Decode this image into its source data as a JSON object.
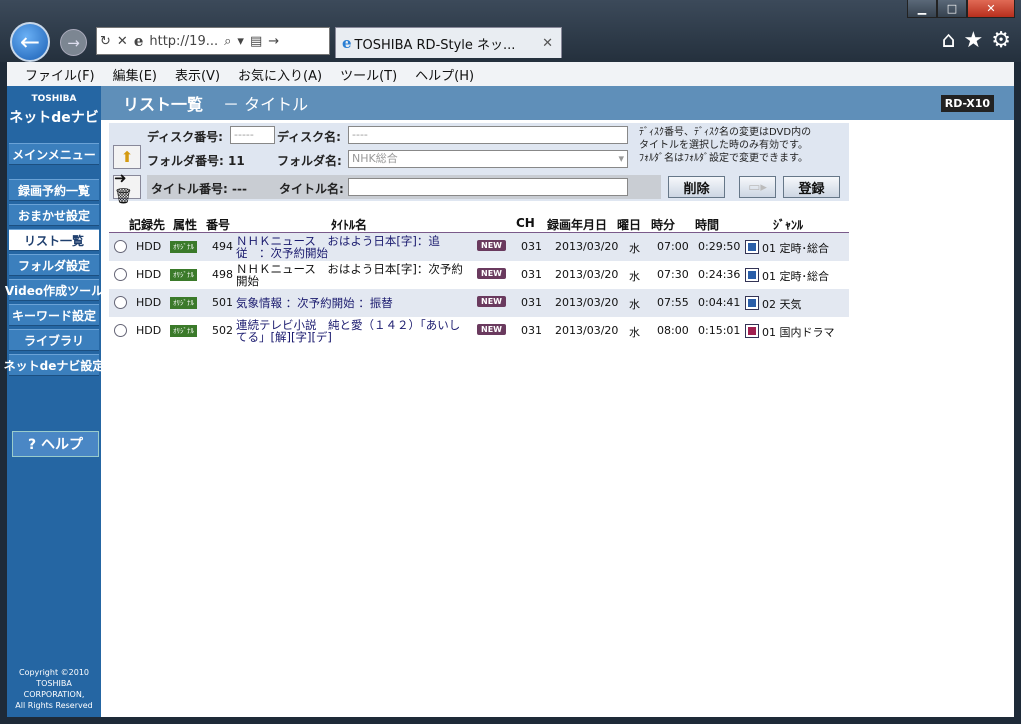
{
  "browser": {
    "address_text": "http://19...",
    "tab_title": "TOSHIBA RD-Style ネッ...",
    "win_min": "▁",
    "win_max": "□",
    "win_close": "✕"
  },
  "menu": [
    "ファイル(F)",
    "編集(E)",
    "表示(V)",
    "お気に入り(A)",
    "ツール(T)",
    "ヘルプ(H)"
  ],
  "sidebar": {
    "brand": "TOSHIBA",
    "product": "ネットdeナビ",
    "main_menu": "メインメニュー",
    "items": [
      "録画予約一覧",
      "おまかせ設定",
      "リスト一覧",
      "フォルダ設定",
      "Video作成ツール",
      "キーワード設定",
      "ライブラリ",
      "ネットdeナビ設定"
    ],
    "help": "? ヘルプ",
    "copyright": [
      "Copyright ©2010",
      "TOSHIBA CORPORATION,",
      "All Rights Reserved"
    ]
  },
  "header": {
    "title": "リスト一覧",
    "subtitle": "－ タイトル",
    "model": "RD-X10"
  },
  "form": {
    "disc_no_label": "ディスク番号:",
    "disc_no_value": "-----",
    "disc_name_label": "ディスク名:",
    "disc_name_value": "----",
    "folder_no_label": "フォルダ番号: 11",
    "folder_name_label": "フォルダ名:",
    "folder_name_value": "NHK総合",
    "title_no_label": "タイトル番号: ---",
    "title_name_label": "タイトル名:",
    "info": [
      "ﾃﾞｨｽｸ番号、ﾃﾞｨｽｸ名の変更はDVD内の",
      "タイトルを選択した時のみ有効です。",
      "ﾌｫﾙﾀﾞ名はﾌｫﾙﾀﾞ設定で変更できます。"
    ],
    "delete_label": "削除",
    "register_label": "登録"
  },
  "table": {
    "headers": [
      "記録先",
      "属性",
      "番号",
      "ﾀｲﾄﾙ名",
      "CH",
      "録画年月日",
      "曜日",
      "時分",
      "時間",
      "ｼﾞｬﾝﾙ"
    ],
    "rows": [
      {
        "dest": "HDD",
        "attr": "ｵﾘｼﾞﾅﾙ",
        "num": "494",
        "title": "ＮＨＫニュース　おはよう日本[字]：追従　：次予約開始",
        "new": "NEW",
        "ch": "031",
        "date": "2013/03/20",
        "dow": "水",
        "time": "07:00",
        "dur": "0:29:50",
        "genre": "01 定時･総合"
      },
      {
        "dest": "HDD",
        "attr": "ｵﾘｼﾞﾅﾙ",
        "num": "498",
        "title": "ＮＨＫニュース　おはよう日本[字]：次予約開始",
        "new": "NEW",
        "ch": "031",
        "date": "2013/03/20",
        "dow": "水",
        "time": "07:30",
        "dur": "0:24:36",
        "genre": "01 定時･総合"
      },
      {
        "dest": "HDD",
        "attr": "ｵﾘｼﾞﾅﾙ",
        "num": "501",
        "title": "気象情報 ：次予約開始 ：振替",
        "new": "NEW",
        "ch": "031",
        "date": "2013/03/20",
        "dow": "水",
        "time": "07:55",
        "dur": "0:04:41",
        "genre": "02 天気"
      },
      {
        "dest": "HDD",
        "attr": "ｵﾘｼﾞﾅﾙ",
        "num": "502",
        "title": "連続テレビ小説　純と愛（１４２）「あいしてる」[解][字][デ]",
        "new": "NEW",
        "ch": "031",
        "date": "2013/03/20",
        "dow": "水",
        "time": "08:00",
        "dur": "0:15:01",
        "genre": "01 国内ドラマ"
      }
    ]
  }
}
